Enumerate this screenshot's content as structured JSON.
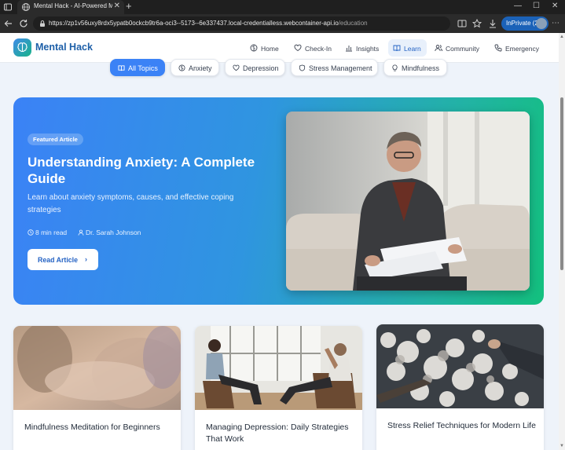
{
  "browser": {
    "tab_title": "Mental Hack - AI-Powered Mental",
    "url_host": "https://zp1v56uxy8rdx5ypatb0ockcb9tr6a-oci3--5173--6e337437.local-credentialless.webcontainer-api.io",
    "url_path": "/education",
    "inprivate_label": "InPrivate (2)"
  },
  "app": {
    "brand": "Mental Hack",
    "nav": [
      {
        "label": "Home",
        "icon": "brain-icon",
        "active": false
      },
      {
        "label": "Check-In",
        "icon": "heart-icon",
        "active": false
      },
      {
        "label": "Insights",
        "icon": "bar-chart-icon",
        "active": false
      },
      {
        "label": "Learn",
        "icon": "book-icon",
        "active": true
      },
      {
        "label": "Community",
        "icon": "users-icon",
        "active": false
      },
      {
        "label": "Emergency",
        "icon": "phone-icon",
        "active": false
      }
    ]
  },
  "filters": [
    {
      "label": "All Topics",
      "icon": "book-icon",
      "active": true
    },
    {
      "label": "Anxiety",
      "icon": "brain-icon",
      "active": false
    },
    {
      "label": "Depression",
      "icon": "heart-icon",
      "active": false
    },
    {
      "label": "Stress Management",
      "icon": "shield-icon",
      "active": false
    },
    {
      "label": "Mindfulness",
      "icon": "lightbulb-icon",
      "active": false
    }
  ],
  "featured": {
    "badge": "Featured Article",
    "title": "Understanding Anxiety: A Complete Guide",
    "description": "Learn about anxiety symptoms, causes, and effective coping strategies",
    "read_time": "8 min read",
    "author": "Dr. Sarah Johnson",
    "cta": "Read Article",
    "cta_icon": "chevron-right-icon"
  },
  "articles": [
    {
      "title": "Mindfulness Meditation for Beginners"
    },
    {
      "title": "Managing Depression: Daily Strategies That Work"
    },
    {
      "title": "Stress Relief Techniques for Modern Life"
    }
  ],
  "colors": {
    "primary": "#3b82f6",
    "brand_text": "#1d5fa8",
    "gradient_start": "#3b82f6",
    "gradient_end": "#13c07e",
    "page_bg": "#eef3fa"
  }
}
